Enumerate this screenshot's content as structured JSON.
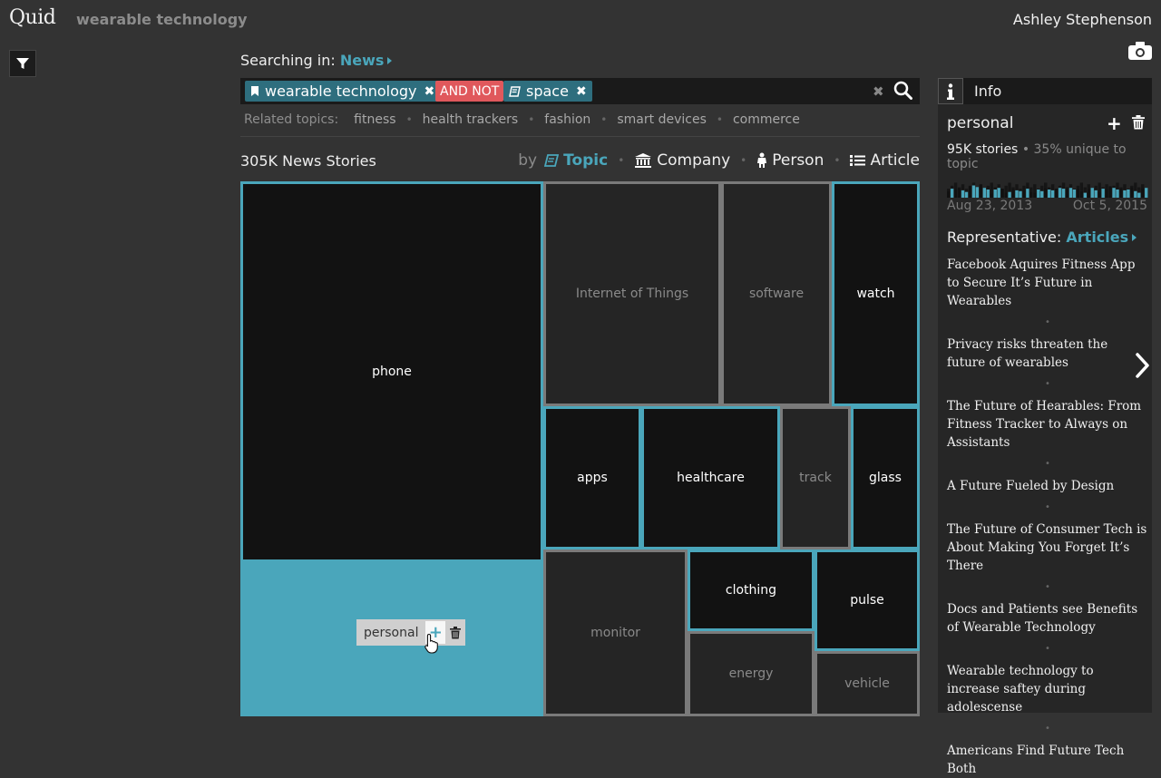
{
  "header": {
    "logo": "Quid",
    "app_title": "wearable technology",
    "user_name": "Ashley Stephenson"
  },
  "search": {
    "searching_prefix": "Searching in:",
    "source": "News",
    "chips": [
      {
        "label": "wearable technology",
        "type": "topic"
      },
      {
        "label": "AND NOT",
        "type": "operator"
      },
      {
        "label": "space",
        "type": "topic"
      }
    ],
    "related_label": "Related topics:",
    "related_topics": [
      "fitness",
      "health trackers",
      "fashion",
      "smart devices",
      "commerce"
    ]
  },
  "results": {
    "count_label": "305K News Stories",
    "by_label": "by",
    "group_options": [
      {
        "label": "Topic",
        "icon": "book-icon",
        "active": true
      },
      {
        "label": "Company",
        "icon": "bank-icon",
        "active": false
      },
      {
        "label": "Person",
        "icon": "person-icon",
        "active": false
      },
      {
        "label": "Article",
        "icon": "list-icon",
        "active": false
      }
    ]
  },
  "treemap": {
    "cells": [
      {
        "label": "phone",
        "style": "dark"
      },
      {
        "label": "personal",
        "style": "selected"
      },
      {
        "label": "Internet of Things",
        "style": "gray"
      },
      {
        "label": "software",
        "style": "gray"
      },
      {
        "label": "watch",
        "style": "dark"
      },
      {
        "label": "apps",
        "style": "dark"
      },
      {
        "label": "healthcare",
        "style": "dark"
      },
      {
        "label": "track",
        "style": "gray"
      },
      {
        "label": "glass",
        "style": "dark"
      },
      {
        "label": "monitor",
        "style": "gray"
      },
      {
        "label": "clothing",
        "style": "dark"
      },
      {
        "label": "pulse",
        "style": "dark"
      },
      {
        "label": "energy",
        "style": "gray"
      },
      {
        "label": "vehicle",
        "style": "gray"
      }
    ],
    "tooltip_label": "personal"
  },
  "info_panel": {
    "header_label": "Info",
    "title": "personal",
    "stories": "95K stories",
    "unique": "• 35% unique to topic",
    "date_start": "Aug 23, 2013",
    "date_end": "Oct 5, 2015",
    "rep_prefix": "Representative:",
    "rep_link": "Articles",
    "articles": [
      "Facebook Aquires Fitness App to Secure It’s Future in Wearables",
      "Privacy risks threaten the future of wearables",
      "The Future of Hearables: From Fitness Tracker to Always on Assistants",
      "A Future Fueled by Design",
      "The Future of Consumer Tech is About Making You Forget It’s There",
      "Docs and Patients see Benefits of Wearable Technology",
      "Wearable technology to increase saftey during adolescense",
      "Americans Find Future Tech Both"
    ]
  },
  "colors": {
    "accent": "#4aa6bb",
    "background": "#333333",
    "not_operator": "#e0585c",
    "chip": "#2e6e7e"
  }
}
